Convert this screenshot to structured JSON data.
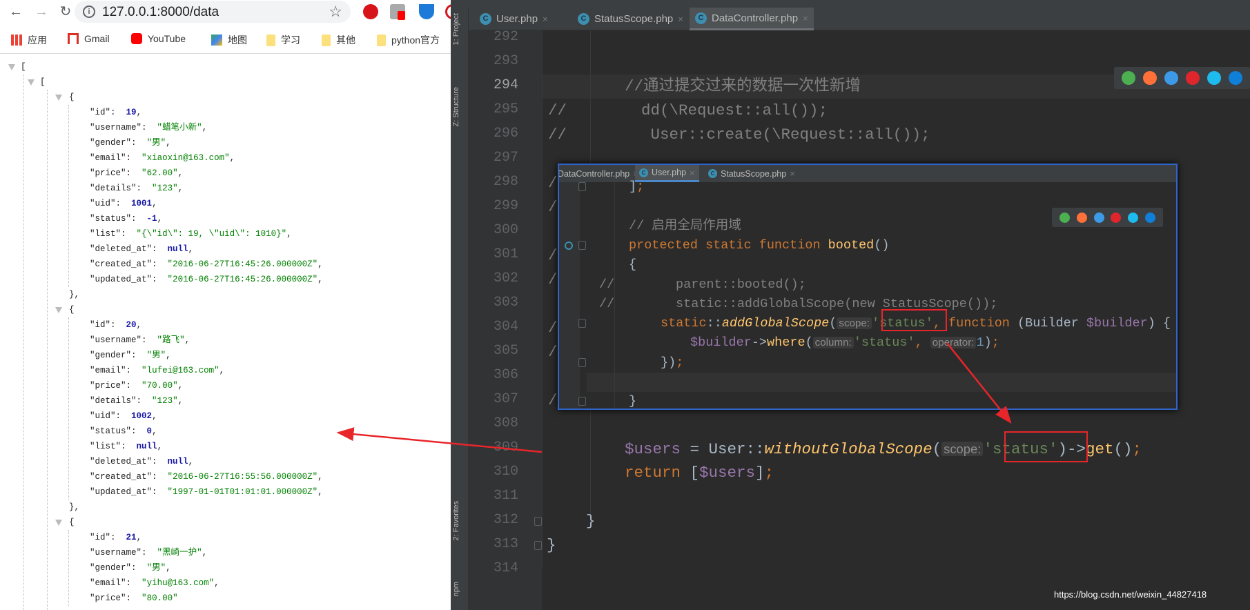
{
  "browser": {
    "url": "127.0.0.1:8000/data",
    "nav": {
      "back_icon": "←",
      "forward_icon": "→",
      "reload_icon": "↻"
    },
    "bookmarks": [
      {
        "label": "应用",
        "icon": "apps-grid-icon"
      },
      {
        "label": "Gmail",
        "icon": "gmail-icon"
      },
      {
        "label": "YouTube",
        "icon": "youtube-icon"
      },
      {
        "label": "地图",
        "icon": "maps-icon"
      },
      {
        "label": "学习",
        "icon": "folder-icon"
      },
      {
        "label": "其他",
        "icon": "folder-icon"
      },
      {
        "label": "python官方",
        "icon": "folder-icon"
      }
    ],
    "json_records": [
      {
        "fields": [
          {
            "k": "id",
            "v": "19",
            "t": "num"
          },
          {
            "k": "username",
            "v": "蜡笔小新",
            "t": "str"
          },
          {
            "k": "gender",
            "v": "男",
            "t": "str"
          },
          {
            "k": "email",
            "v": "xiaoxin@163.com",
            "t": "str"
          },
          {
            "k": "price",
            "v": "62.00",
            "t": "str"
          },
          {
            "k": "details",
            "v": "123",
            "t": "str"
          },
          {
            "k": "uid",
            "v": "1001",
            "t": "num"
          },
          {
            "k": "status",
            "v": "-1",
            "t": "num"
          },
          {
            "k": "list",
            "v": "{\\\"id\\\": 19, \\\"uid\\\": 1010}",
            "t": "str"
          },
          {
            "k": "deleted_at",
            "v": "null",
            "t": "nul"
          },
          {
            "k": "created_at",
            "v": "2016-06-27T16:45:26.000000Z",
            "t": "str"
          },
          {
            "k": "updated_at",
            "v": "2016-06-27T16:45:26.000000Z",
            "t": "str"
          }
        ]
      },
      {
        "fields": [
          {
            "k": "id",
            "v": "20",
            "t": "num"
          },
          {
            "k": "username",
            "v": "路飞",
            "t": "str"
          },
          {
            "k": "gender",
            "v": "男",
            "t": "str"
          },
          {
            "k": "email",
            "v": "lufei@163.com",
            "t": "str"
          },
          {
            "k": "price",
            "v": "70.00",
            "t": "str"
          },
          {
            "k": "details",
            "v": "123",
            "t": "str"
          },
          {
            "k": "uid",
            "v": "1002",
            "t": "num"
          },
          {
            "k": "status",
            "v": "0",
            "t": "num"
          },
          {
            "k": "list",
            "v": "null",
            "t": "nul"
          },
          {
            "k": "deleted_at",
            "v": "null",
            "t": "nul"
          },
          {
            "k": "created_at",
            "v": "2016-06-27T16:55:56.000000Z",
            "t": "str"
          },
          {
            "k": "updated_at",
            "v": "1997-01-01T01:01:01.000000Z",
            "t": "str"
          }
        ]
      },
      {
        "fields": [
          {
            "k": "id",
            "v": "21",
            "t": "num"
          },
          {
            "k": "username",
            "v": "黑崎一护",
            "t": "str"
          },
          {
            "k": "gender",
            "v": "男",
            "t": "str"
          },
          {
            "k": "email",
            "v": "yihu@163.com",
            "t": "str"
          },
          {
            "k": "price",
            "v": "80.00",
            "t": "str"
          }
        ]
      }
    ]
  },
  "ide": {
    "tool_windows": [
      "1: Project",
      "Z: Structure",
      "2: Favorites",
      "npm"
    ],
    "tabs": [
      {
        "label": "User.php",
        "active": false
      },
      {
        "label": "StatusScope.php",
        "active": false
      },
      {
        "label": "DataController.php",
        "active": true
      }
    ],
    "tab_close": "×",
    "file_icon_letter": "C",
    "line_numbers": [
      "292",
      "293",
      "294",
      "295",
      "296",
      "297",
      "298",
      "299",
      "300",
      "301",
      "302",
      "303",
      "304",
      "305",
      "306",
      "307",
      "308",
      "309",
      "310",
      "311",
      "312",
      "313",
      "314"
    ],
    "current_line": "294",
    "code_lines": [
      {
        "line": "294",
        "segs": [
          {
            "c": "c",
            "t": "//通过提交过来的数据一次性新增"
          }
        ]
      },
      {
        "line": "295",
        "segs": [
          {
            "c": "c",
            "t": "//        dd(\\Request::all());"
          }
        ]
      },
      {
        "line": "296",
        "segs": [
          {
            "c": "c",
            "t": "//         User::create(\\Request::all());"
          }
        ]
      },
      {
        "line": "298",
        "segs": [
          {
            "c": "c",
            "t": "//"
          }
        ]
      },
      {
        "line": "299",
        "segs": [
          {
            "c": "c",
            "t": "//"
          }
        ]
      },
      {
        "line": "301",
        "segs": [
          {
            "c": "c",
            "t": "//"
          }
        ]
      },
      {
        "line": "302",
        "segs": [
          {
            "c": "c",
            "t": "//"
          }
        ]
      },
      {
        "line": "304",
        "segs": [
          {
            "c": "c",
            "t": "//"
          }
        ]
      },
      {
        "line": "305",
        "segs": [
          {
            "c": "c",
            "t": "//"
          }
        ]
      },
      {
        "line": "307",
        "segs": [
          {
            "c": "c",
            "t": "//"
          }
        ]
      },
      {
        "line": "309",
        "segs": [
          {
            "c": "v",
            "t": "$users"
          },
          {
            "c": "d",
            "t": " = User::"
          },
          {
            "c": "fn",
            "t": "withoutGlobalScope"
          },
          {
            "c": "d",
            "t": "("
          },
          {
            "c": "hint",
            "t": "scope:"
          },
          {
            "c": "s",
            "t": "'status'"
          },
          {
            "c": "d",
            "t": ")->"
          },
          {
            "c": "f2",
            "t": "get"
          },
          {
            "c": "d",
            "t": "()"
          },
          {
            "c": "kw",
            "t": ";"
          }
        ]
      },
      {
        "line": "310",
        "segs": [
          {
            "c": "kw",
            "t": "return "
          },
          {
            "c": "d",
            "t": "["
          },
          {
            "c": "v",
            "t": "$users"
          },
          {
            "c": "d",
            "t": "]"
          },
          {
            "c": "kw",
            "t": ";"
          }
        ]
      },
      {
        "line": "312",
        "segs": [
          {
            "c": "d",
            "t": "}"
          }
        ]
      },
      {
        "line": "313",
        "segs": [
          {
            "c": "d",
            "t": "}"
          }
        ]
      }
    ],
    "popup": {
      "tabs": [
        {
          "label": "DataController.php",
          "active": false
        },
        {
          "label": "User.php",
          "active": true
        },
        {
          "label": "StatusScope.php",
          "active": false
        }
      ],
      "lines": [
        {
          "segs": [
            {
              "c": "d",
              "t": "]"
            },
            {
              "c": "kw",
              "t": ";"
            }
          ]
        },
        {
          "segs": []
        },
        {
          "segs": [
            {
              "c": "c",
              "t": "// 启用全局作用域"
            }
          ]
        },
        {
          "segs": [
            {
              "c": "kw",
              "t": "protected static function "
            },
            {
              "c": "f2",
              "t": "booted"
            },
            {
              "c": "d",
              "t": "()"
            }
          ]
        },
        {
          "segs": [
            {
              "c": "d",
              "t": "{"
            }
          ]
        },
        {
          "segs": [
            {
              "c": "c",
              "t": "//        parent::booted();"
            }
          ]
        },
        {
          "segs": [
            {
              "c": "c",
              "t": "//        static::addGlobalScope(new StatusScope());"
            }
          ]
        },
        {
          "segs": [
            {
              "c": "kw",
              "t": "static"
            },
            {
              "c": "d",
              "t": "::"
            },
            {
              "c": "fn",
              "t": "addGlobalScope"
            },
            {
              "c": "d",
              "t": "("
            },
            {
              "c": "hint",
              "t": "scope:"
            },
            {
              "c": "s",
              "t": "'status'"
            },
            {
              "c": "kw",
              "t": ", function "
            },
            {
              "c": "d",
              "t": "(Builder "
            },
            {
              "c": "v",
              "t": "$builder"
            },
            {
              "c": "d",
              "t": ") {"
            }
          ]
        },
        {
          "segs": [
            {
              "c": "v",
              "t": "$builder"
            },
            {
              "c": "d",
              "t": "->"
            },
            {
              "c": "f2",
              "t": "where"
            },
            {
              "c": "d",
              "t": "("
            },
            {
              "c": "hint",
              "t": "column:"
            },
            {
              "c": "s",
              "t": "'status'"
            },
            {
              "c": "kw",
              "t": ", "
            },
            {
              "c": "hint",
              "t": "operator:"
            },
            {
              "c": "n",
              "t": "1"
            },
            {
              "c": "d",
              "t": ")"
            },
            {
              "c": "kw",
              "t": ";"
            }
          ]
        },
        {
          "segs": [
            {
              "c": "d",
              "t": "})"
            },
            {
              "c": "kw",
              "t": ";"
            }
          ]
        },
        {
          "segs": []
        },
        {
          "segs": [
            {
              "c": "d",
              "t": "}"
            }
          ]
        }
      ]
    },
    "browser_icons": [
      "chrome-icon",
      "firefox-icon",
      "safari-icon",
      "opera-icon",
      "ie-icon",
      "edge-icon"
    ],
    "browser_icon_colors": [
      "#4caf50",
      "#ff7139",
      "#3d9ae8",
      "#e0262d",
      "#1ebbee",
      "#0f7fd8"
    ]
  },
  "annotation_color": "#e8262a",
  "watermark": "https://blog.csdn.net/weixin_44827418"
}
